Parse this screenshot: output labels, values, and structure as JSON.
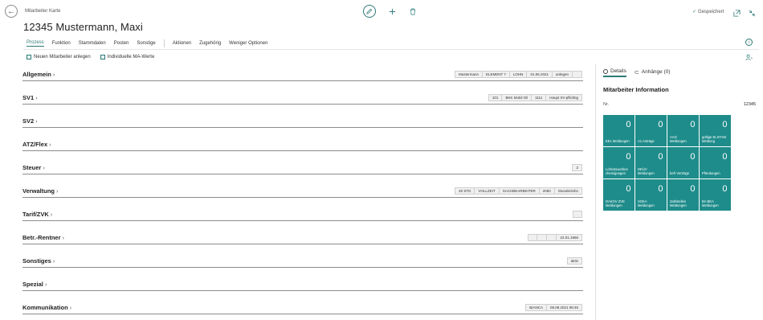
{
  "header": {
    "breadcrumb": "Mitarbeiter Karte",
    "title": "12345 Mustermann, Maxi",
    "saved_label": "Gespeichert",
    "back_glyph": "←",
    "check_glyph": "✓"
  },
  "actions": {
    "items": [
      {
        "label": "Prozess",
        "active": true
      },
      {
        "label": "Funktion"
      },
      {
        "label": "Stammdaten"
      },
      {
        "label": "Posten"
      },
      {
        "label": "Sonstige"
      },
      {
        "label": "Aktionen"
      },
      {
        "label": "Zugehörig"
      },
      {
        "label": "Weniger Optionen"
      }
    ],
    "sub": [
      {
        "label": "Neuen Mitarbeiter anlegen"
      },
      {
        "label": "Individuelle MA-Werte"
      }
    ]
  },
  "sections": [
    {
      "title": "Allgemein",
      "chips": [
        "Mustermann",
        "ELEMENT 7",
        "LOHN",
        "01.06.2021",
        "anlegen",
        ""
      ]
    },
    {
      "title": "SV1",
      "chips": [
        "101",
        "BKK Mobil Oil",
        "1111",
        "Haupt SV-pflichtig"
      ]
    },
    {
      "title": "SV2",
      "chips": []
    },
    {
      "title": "ATZ/Flex",
      "chips": []
    },
    {
      "title": "Steuer",
      "chips": [
        "2"
      ]
    },
    {
      "title": "Verwaltung",
      "chips": [
        "40 STD",
        "VOLLZEIT",
        "SACHBEARBEITER",
        "2050",
        "Stundenlohn"
      ]
    },
    {
      "title": "Tarif/ZVK",
      "chips": [
        ""
      ]
    },
    {
      "title": "Betr.-Rentner",
      "chips": [
        "",
        "",
        "",
        "22.01.1966"
      ]
    },
    {
      "title": "Sonstiges",
      "chips": [
        "aktiv"
      ]
    },
    {
      "title": "Spezial",
      "chips": []
    },
    {
      "title": "Kommunikation",
      "chips": [
        "BIANCA",
        "08.09.2021 08:45"
      ]
    }
  ],
  "factbox": {
    "tabs": [
      {
        "label": "Details",
        "active": true
      },
      {
        "label": "Anhänge (0)"
      }
    ],
    "heading": "Mitarbeiter Information",
    "nr_label": "Nr.",
    "nr_value": "12345",
    "tile_color": "#1e8c8a",
    "tiles": [
      {
        "value": "0",
        "label": "EEL Meldungen"
      },
      {
        "value": "0",
        "label": "A1 Anträge"
      },
      {
        "value": "0",
        "label": "AAG\nMeldungen"
      },
      {
        "value": "0",
        "label": "gültige ELSTAM\nMeldung"
      },
      {
        "value": "0",
        "label": "Lohnsteuerbes\ncheinigungen"
      },
      {
        "value": "0",
        "label": "DEÜV\nMeldungen"
      },
      {
        "value": "0",
        "label": "befr Verträge"
      },
      {
        "value": "0",
        "label": "Pfändungen"
      },
      {
        "value": "0",
        "label": "DAKOV ZVE\nMeldungen"
      },
      {
        "value": "0",
        "label": "SOKA\nMeldungen"
      },
      {
        "value": "0",
        "label": "Zahlstellen\nMeldungen"
      },
      {
        "value": "0",
        "label": "BA BEA\nMeldungen"
      }
    ]
  }
}
